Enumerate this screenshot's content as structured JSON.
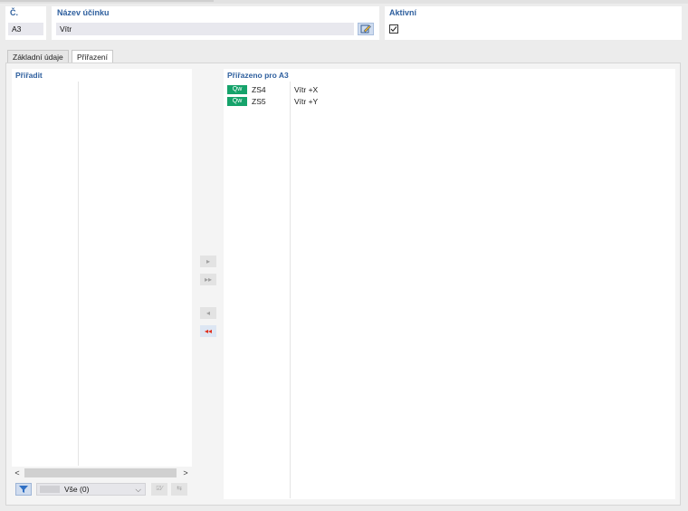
{
  "header": {
    "no_label": "Č.",
    "no_value": "A3",
    "name_label": "Název účinku",
    "name_value": "Vítr",
    "active_label": "Aktivní",
    "active_checked": true
  },
  "tabs": [
    {
      "label": "Základní údaje",
      "active": false
    },
    {
      "label": "Přiřazení",
      "active": true
    }
  ],
  "left_list": {
    "title": "Přiřadit",
    "items": []
  },
  "right_list": {
    "title": "Přiřazeno pro A3",
    "items": [
      {
        "badge": "Qw",
        "code": "ZS4",
        "name": "Vítr +X"
      },
      {
        "badge": "Qw",
        "code": "ZS5",
        "name": "Vítr +Y"
      }
    ]
  },
  "transfer_buttons": {
    "add_one": "▸",
    "add_all": "▸▸",
    "remove_one": "◂",
    "remove_all": "◂◂"
  },
  "bottom_bar": {
    "filter_value": "Vše (0)"
  },
  "colors": {
    "accent": "#2e5f9e",
    "badge_green": "#16a36b",
    "remove_all_red": "#e0301e"
  }
}
